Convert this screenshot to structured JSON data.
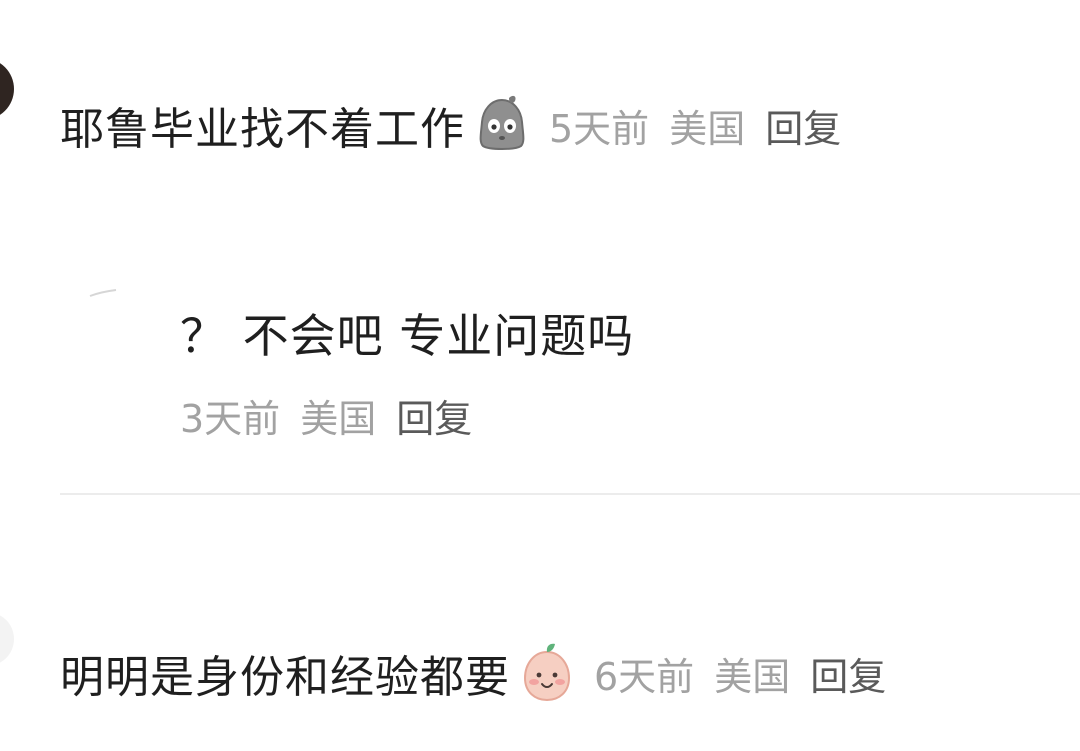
{
  "comments": [
    {
      "text": "耶鲁毕业找不着工作",
      "emoji": "worried-ghost-emoji",
      "time": "5天前",
      "location": "美国",
      "reply_label": "回复",
      "replies": [
        {
          "text": "？ 不会吧  专业问题吗",
          "time": "3天前",
          "location": "美国",
          "reply_label": "回复"
        }
      ]
    },
    {
      "text": "明明是身份和经验都要",
      "emoji": "smiling-peach-emoji",
      "time": "6天前",
      "location": "美国",
      "reply_label": "回复"
    }
  ],
  "colors": {
    "text": "#1f1f1f",
    "meta": "#a2a2a2",
    "reply_action": "#5a5a5a",
    "divider": "#ececec"
  }
}
